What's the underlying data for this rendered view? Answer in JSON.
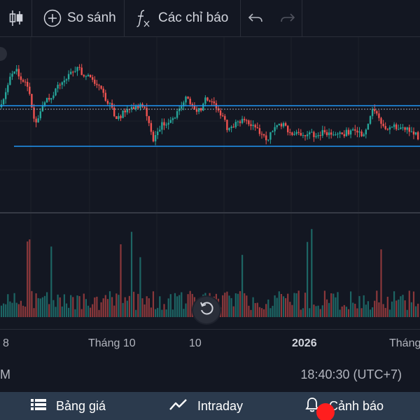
{
  "toolbar": {
    "chart_type_icon": "candlestick-icon",
    "compare_icon": "plus-circle-icon",
    "compare_label": "So sánh",
    "indicators_icon": "function-icon",
    "indicators_label": "Các chỉ báo",
    "undo_icon": "undo-icon",
    "redo_icon": "redo-icon"
  },
  "chart": {
    "type": "candlestick",
    "up_color": "#26a69a",
    "down_color": "#ef5350",
    "level_line_color": "#2196f3"
  },
  "time_axis": {
    "labels": [
      "8",
      "Tháng 10",
      "10",
      "2026",
      "Tháng"
    ]
  },
  "status": {
    "left_text": "M",
    "time": "18:40:30 (UTC+7)"
  },
  "bottom_bar": {
    "price_board_icon": "list-icon",
    "price_board_label": "Bảng giá",
    "intraday_icon": "trend-line-icon",
    "intraday_label": "Intraday",
    "alerts_icon": "bell-icon",
    "alerts_label": "Cảnh báo",
    "background": "#2b3a4d"
  }
}
